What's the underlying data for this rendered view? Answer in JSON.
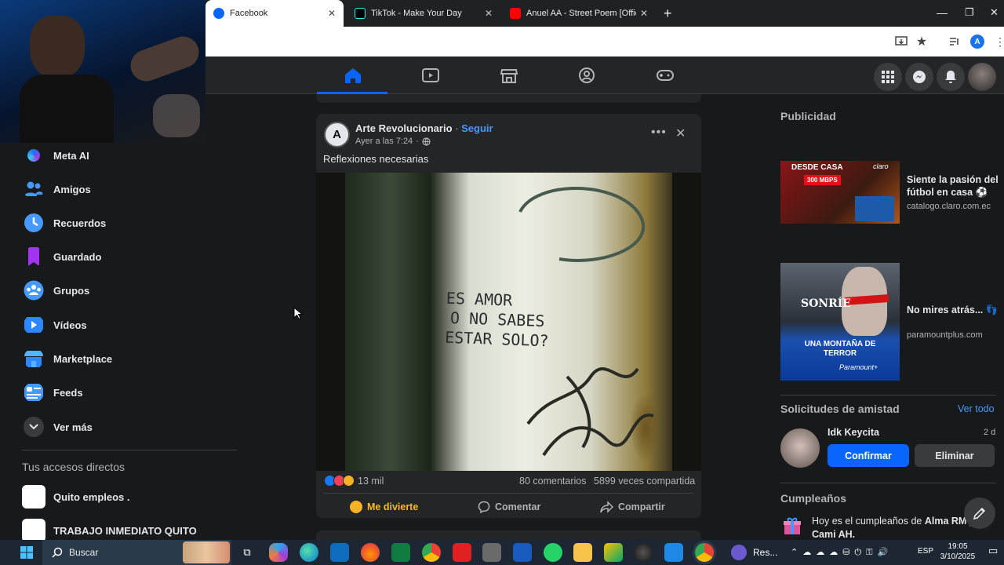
{
  "browser": {
    "tabs": [
      {
        "title": "Facebook",
        "active": true
      },
      {
        "title": "TikTok - Make Your Day",
        "active": false
      },
      {
        "title": "Anuel AA - Street Poem [Offici",
        "active": false
      }
    ],
    "new_tab": "+",
    "profile_initial": "A"
  },
  "sidebar": {
    "items": [
      {
        "label": "Meta AI",
        "icon": "meta-ai-icon"
      },
      {
        "label": "Amigos",
        "icon": "friends-icon"
      },
      {
        "label": "Recuerdos",
        "icon": "memories-icon"
      },
      {
        "label": "Guardado",
        "icon": "saved-icon"
      },
      {
        "label": "Grupos",
        "icon": "groups-icon"
      },
      {
        "label": "Vídeos",
        "icon": "video-icon"
      },
      {
        "label": "Marketplace",
        "icon": "marketplace-icon"
      },
      {
        "label": "Feeds",
        "icon": "feeds-icon"
      },
      {
        "label": "Ver más",
        "icon": "chevron-down-icon"
      }
    ],
    "shortcuts_title": "Tus accesos directos",
    "shortcuts": [
      {
        "label": "Quito empleos ."
      },
      {
        "label": "TRABAJO INMEDIATO QUITO"
      }
    ]
  },
  "post": {
    "author": "Arte Revolucionario",
    "separator": "·",
    "follow": "Seguir",
    "time": "Ayer a las 7:24",
    "text": "Reflexiones necesarias",
    "image_text": [
      "ES AMOR",
      "O NO SABES",
      "ESTAR SOLO?"
    ],
    "reactions": "13 mil",
    "comments": "80 comentarios",
    "shares": "5899 veces compartida",
    "actions": {
      "react": "Me divierte",
      "comment": "Comentar",
      "share": "Compartir"
    }
  },
  "right": {
    "ads_title": "Publicidad",
    "ads": [
      {
        "title": "Siente la pasión del fútbol en casa ⚽",
        "domain": "catalogo.claro.com.ec",
        "img_line1": "DESDE CASA",
        "img_line2": "300 MBPS",
        "img_brand": "claro"
      },
      {
        "title": "No mires atrás... 👣",
        "domain": "paramountplus.com",
        "img_line1": "SONRÍE",
        "img_line2": "UNA MONTAÑA DE TERROR",
        "img_brand": "Paramount+"
      }
    ],
    "friend_requests_title": "Solicitudes de amistad",
    "see_all": "Ver todo",
    "request": {
      "name": "Idk Keycita",
      "time": "2 d",
      "confirm": "Confirmar",
      "delete": "Eliminar"
    },
    "birthdays_title": "Cumpleaños",
    "birthday_prefix": "Hoy es el cumpleaños de ",
    "birthday_names": "Alma RM y Cami AH."
  },
  "taskbar": {
    "search": "Buscar",
    "app_label": "Res...",
    "lang": "ESP",
    "time": "19:05",
    "date": "3/10/2025"
  },
  "colors": {
    "accent": "#0866ff",
    "link": "#4599ff",
    "bg": "#18191a",
    "card": "#242526"
  }
}
